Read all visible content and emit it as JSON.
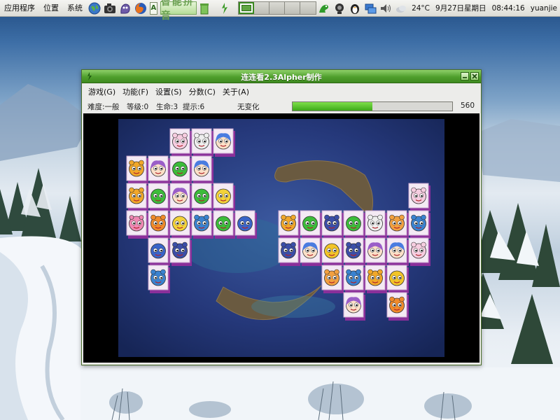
{
  "top_panel": {
    "menus": [
      "应用程序",
      "位置",
      "系统"
    ],
    "lang_label": "A",
    "ime_label": "智能拼音",
    "workspaces": [
      false,
      true,
      false,
      false,
      false
    ],
    "temperature": "24°C",
    "date": "9月27日星期日",
    "time": "08:44:16",
    "user": "yuanjie"
  },
  "window": {
    "title": "连连看2.3Alpher制作",
    "menus": [
      {
        "label": "游戏(G)"
      },
      {
        "label": "功能(F)"
      },
      {
        "label": "设置(S)"
      },
      {
        "label": "分数(C)"
      },
      {
        "label": "关于(A)"
      }
    ],
    "status": {
      "difficulty": "难度:一般",
      "level": "等级:0",
      "lives": "生命:3",
      "hints": "提示:6",
      "change": "无变化",
      "progress": 0.5,
      "score": "560"
    }
  },
  "board": {
    "tile_types": {
      "pinkcat": "#f6cde0",
      "whitedog": "#eeeeee",
      "bluegirl": "#4a7ce0",
      "yellowcat": "#f1a72a",
      "purplegirl": "#9a5ec8",
      "greenfrog": "#3cbc3a",
      "yellowchick": "#f3d23a",
      "pinkrabbit": "#f088b4",
      "orangelion": "#f08a2a",
      "bluedog": "#3a82d0",
      "blueshark": "#3a64c8",
      "bluecat": "#3c4ea8",
      "yellowfish": "#f2c428",
      "orangemonkey": "#f2a040"
    },
    "tiles": [
      {
        "c": 3,
        "r": 0,
        "t": "pinkcat"
      },
      {
        "c": 4,
        "r": 0,
        "t": "whitedog"
      },
      {
        "c": 5,
        "r": 0,
        "t": "bluegirl"
      },
      {
        "c": 1,
        "r": 1,
        "t": "yellowcat"
      },
      {
        "c": 2,
        "r": 1,
        "t": "purplegirl"
      },
      {
        "c": 3,
        "r": 1,
        "t": "greenfrog"
      },
      {
        "c": 4,
        "r": 1,
        "t": "bluegirl"
      },
      {
        "c": 1,
        "r": 2,
        "t": "yellowcat"
      },
      {
        "c": 2,
        "r": 2,
        "t": "greenfrog"
      },
      {
        "c": 3,
        "r": 2,
        "t": "purplegirl"
      },
      {
        "c": 4,
        "r": 2,
        "t": "greenfrog"
      },
      {
        "c": 5,
        "r": 2,
        "t": "yellowchick"
      },
      {
        "c": 1,
        "r": 3,
        "t": "pinkrabbit"
      },
      {
        "c": 2,
        "r": 3,
        "t": "orangelion"
      },
      {
        "c": 3,
        "r": 3,
        "t": "yellowchick"
      },
      {
        "c": 4,
        "r": 3,
        "t": "bluedog"
      },
      {
        "c": 5,
        "r": 3,
        "t": "greenfrog"
      },
      {
        "c": 6,
        "r": 3,
        "t": "blueshark"
      },
      {
        "c": 2,
        "r": 4,
        "t": "blueshark"
      },
      {
        "c": 3,
        "r": 4,
        "t": "bluecat"
      },
      {
        "c": 2,
        "r": 5,
        "t": "bluedog"
      },
      {
        "c": 14,
        "r": 2,
        "t": "pinkcat"
      },
      {
        "c": 8,
        "r": 3,
        "t": "yellowcat"
      },
      {
        "c": 9,
        "r": 3,
        "t": "greenfrog"
      },
      {
        "c": 10,
        "r": 3,
        "t": "bluecat"
      },
      {
        "c": 11,
        "r": 3,
        "t": "greenfrog"
      },
      {
        "c": 12,
        "r": 3,
        "t": "whitedog"
      },
      {
        "c": 13,
        "r": 3,
        "t": "orangemonkey"
      },
      {
        "c": 14,
        "r": 3,
        "t": "bluedog"
      },
      {
        "c": 8,
        "r": 4,
        "t": "bluecat"
      },
      {
        "c": 9,
        "r": 4,
        "t": "bluegirl"
      },
      {
        "c": 10,
        "r": 4,
        "t": "yellowfish"
      },
      {
        "c": 11,
        "r": 4,
        "t": "bluecat"
      },
      {
        "c": 12,
        "r": 4,
        "t": "purplegirl"
      },
      {
        "c": 13,
        "r": 4,
        "t": "bluegirl"
      },
      {
        "c": 14,
        "r": 4,
        "t": "pinkcat"
      },
      {
        "c": 10,
        "r": 5,
        "t": "orangemonkey"
      },
      {
        "c": 11,
        "r": 5,
        "t": "bluedog"
      },
      {
        "c": 12,
        "r": 5,
        "t": "yellowcat"
      },
      {
        "c": 13,
        "r": 5,
        "t": "yellowfish"
      },
      {
        "c": 11,
        "r": 6,
        "t": "purplegirl"
      },
      {
        "c": 13,
        "r": 6,
        "t": "orangelion"
      }
    ]
  },
  "colors": {
    "titlebar": "#4f9f2c",
    "progress": "#3ea81a",
    "tile_face": "#ffffff",
    "tile_edge": "#8b2f9a",
    "sea": "#1c2e6a"
  }
}
